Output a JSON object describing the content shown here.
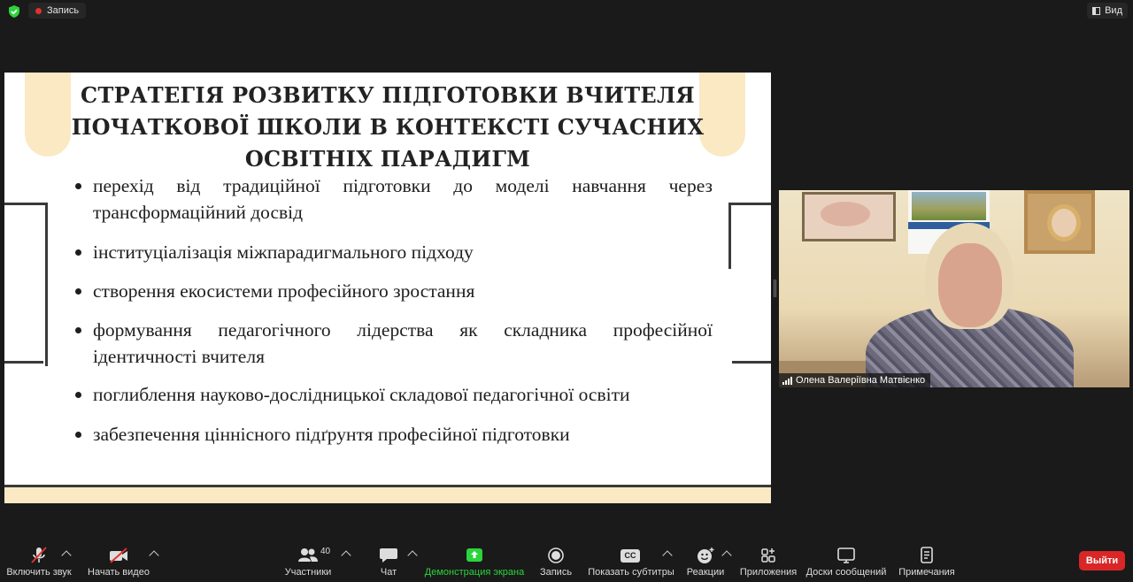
{
  "top_bar": {
    "recording_label": "Запись",
    "view_label": "Вид"
  },
  "slide": {
    "title": "СТРАТЕГІЯ РОЗВИТКУ ПІДГОТОВКИ ВЧИТЕЛЯ ПОЧАТКОВОЇ ШКОЛИ В КОНТЕКСТІ СУЧАСНИХ ОСВІТНІХ ПАРАДИГМ",
    "bullets": [
      "перехід від традиційної підготовки до моделі навчання через трансформаційний досвід",
      "інституціалізація міжпарадигмального підходу",
      "створення екосистеми професійного зростання",
      "формування педагогічного лідерства як складника професійної ідентичності вчителя",
      "поглиблення науково-дослідницької складової педагогічної освіти",
      "забезпечення ціннісного підґрунтя професійної підготовки"
    ]
  },
  "video": {
    "participant_name": "Олена Валеріївна Матвієнко"
  },
  "toolbar": {
    "unmute_label": "Включить звук",
    "start_video_label": "Начать видео",
    "participants_label": "Участники",
    "participants_count": "40",
    "chat_label": "Чат",
    "share_screen_label": "Демонстрация экрана",
    "record_label": "Запись",
    "captions_label": "Показать субтитры",
    "captions_icon_text": "CC",
    "reactions_label": "Реакции",
    "apps_label": "Приложения",
    "whiteboards_label": "Доски сообщений",
    "notes_label": "Примечания",
    "leave_label": "Выйти"
  },
  "colors": {
    "accent_green": "#2bd43c",
    "leave_red": "#d92626",
    "slide_accent": "#fbe9c4"
  }
}
